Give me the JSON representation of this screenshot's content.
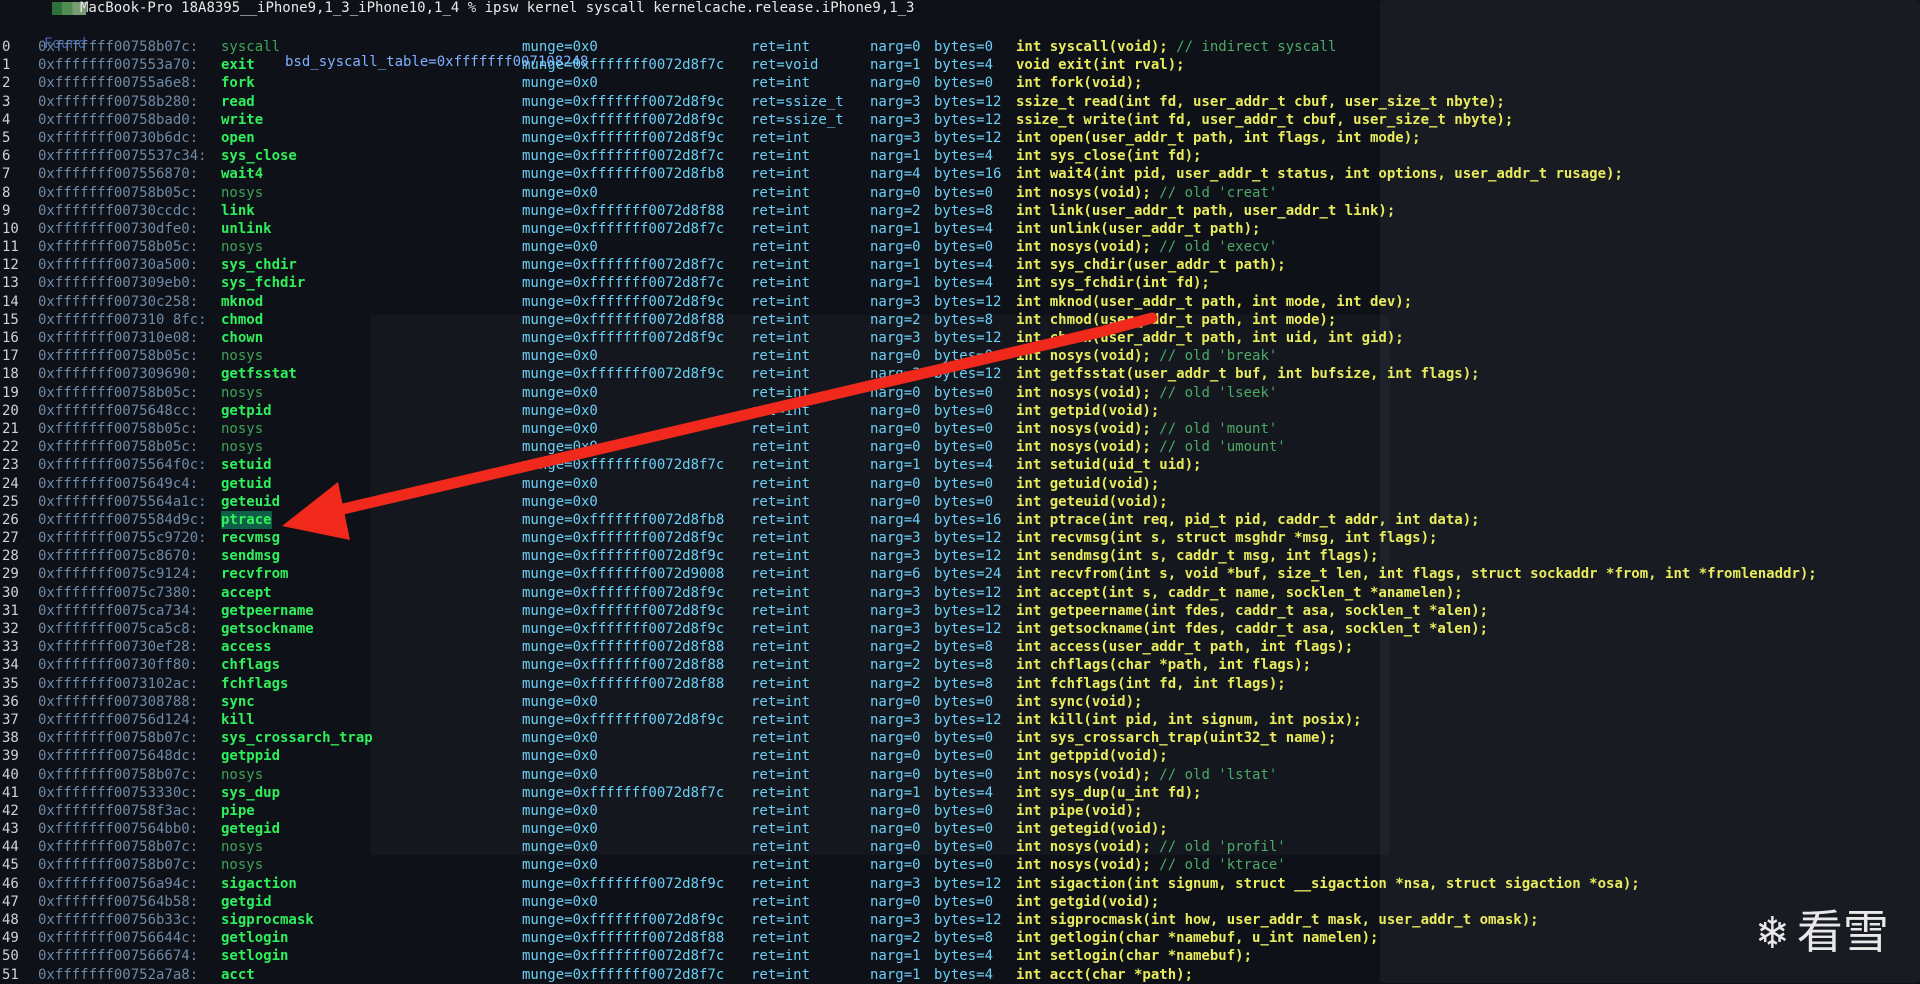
{
  "header": {
    "host": "MacBook-Pro",
    "path": "18A8395__iPhone9,1_3_iPhone10,1_4",
    "prompt_char": "%",
    "command": "ipsw kernel syscall kernelcache.release.iPhone9,1_3",
    "found_label": "Found",
    "table_label": "bsd_syscall_table=0xfffffff007108248"
  },
  "rows": [
    {
      "num": "0",
      "addr": "0xfffffff00758b07c:",
      "name": "syscall",
      "munge": "munge=0x0",
      "ret": "ret=int",
      "narg": "narg=0",
      "bytes": "bytes=0",
      "proto": "int syscall(void); ",
      "comment": "// indirect syscall"
    },
    {
      "num": "1",
      "addr": "0xfffffff007553a70:",
      "name": "exit",
      "munge": "munge=0xfffffff0072d8f7c",
      "ret": "ret=void",
      "narg": "narg=1",
      "bytes": "bytes=4",
      "proto": "void exit(int rval);",
      "comment": ""
    },
    {
      "num": "2",
      "addr": "0xfffffff00755a6e8:",
      "name": "fork",
      "munge": "munge=0x0",
      "ret": "ret=int",
      "narg": "narg=0",
      "bytes": "bytes=0",
      "proto": "int fork(void);",
      "comment": ""
    },
    {
      "num": "3",
      "addr": "0xfffffff00758b280:",
      "name": "read",
      "munge": "munge=0xfffffff0072d8f9c",
      "ret": "ret=ssize_t",
      "narg": "narg=3",
      "bytes": "bytes=12",
      "proto": "ssize_t read(int fd, user_addr_t cbuf, user_size_t nbyte);",
      "comment": ""
    },
    {
      "num": "4",
      "addr": "0xfffffff00758bad0:",
      "name": "write",
      "munge": "munge=0xfffffff0072d8f9c",
      "ret": "ret=ssize_t",
      "narg": "narg=3",
      "bytes": "bytes=12",
      "proto": "ssize_t write(int fd, user_addr_t cbuf, user_size_t nbyte);",
      "comment": ""
    },
    {
      "num": "5",
      "addr": "0xfffffff00730b6dc:",
      "name": "open",
      "munge": "munge=0xfffffff0072d8f9c",
      "ret": "ret=int",
      "narg": "narg=3",
      "bytes": "bytes=12",
      "proto": "int open(user_addr_t path, int flags, int mode);",
      "comment": ""
    },
    {
      "num": "6",
      "addr": "0xfffffff0075537c34:",
      "name": "sys_close",
      "munge": "munge=0xfffffff0072d8f7c",
      "ret": "ret=int",
      "narg": "narg=1",
      "bytes": "bytes=4",
      "proto": "int sys_close(int fd);",
      "comment": ""
    },
    {
      "num": "7",
      "addr": "0xfffffff007556870:",
      "name": "wait4",
      "munge": "munge=0xfffffff0072d8fb8",
      "ret": "ret=int",
      "narg": "narg=4",
      "bytes": "bytes=16",
      "proto": "int wait4(int pid, user_addr_t status, int options, user_addr_t rusage);",
      "comment": ""
    },
    {
      "num": "8",
      "addr": "0xfffffff00758b05c:",
      "name": "nosys",
      "munge": "munge=0x0",
      "ret": "ret=int",
      "narg": "narg=0",
      "bytes": "bytes=0",
      "proto": "int nosys(void); ",
      "comment": "// old 'creat'"
    },
    {
      "num": "9",
      "addr": "0xfffffff00730ccdc:",
      "name": "link",
      "munge": "munge=0xfffffff0072d8f88",
      "ret": "ret=int",
      "narg": "narg=2",
      "bytes": "bytes=8",
      "proto": "int link(user_addr_t path, user_addr_t link);",
      "comment": ""
    },
    {
      "num": "10",
      "addr": "0xfffffff00730dfe0:",
      "name": "unlink",
      "munge": "munge=0xfffffff0072d8f7c",
      "ret": "ret=int",
      "narg": "narg=1",
      "bytes": "bytes=4",
      "proto": "int unlink(user_addr_t path);",
      "comment": ""
    },
    {
      "num": "11",
      "addr": "0xfffffff00758b05c:",
      "name": "nosys",
      "munge": "munge=0x0",
      "ret": "ret=int",
      "narg": "narg=0",
      "bytes": "bytes=0",
      "proto": "int nosys(void); ",
      "comment": "// old 'execv'"
    },
    {
      "num": "12",
      "addr": "0xfffffff00730a500:",
      "name": "sys_chdir",
      "munge": "munge=0xfffffff0072d8f7c",
      "ret": "ret=int",
      "narg": "narg=1",
      "bytes": "bytes=4",
      "proto": "int sys_chdir(user_addr_t path);",
      "comment": ""
    },
    {
      "num": "13",
      "addr": "0xfffffff007309eb0:",
      "name": "sys_fchdir",
      "munge": "munge=0xfffffff0072d8f7c",
      "ret": "ret=int",
      "narg": "narg=1",
      "bytes": "bytes=4",
      "proto": "int sys_fchdir(int fd);",
      "comment": ""
    },
    {
      "num": "14",
      "addr": "0xfffffff00730c258:",
      "name": "mknod",
      "munge": "munge=0xfffffff0072d8f9c",
      "ret": "ret=int",
      "narg": "narg=3",
      "bytes": "bytes=12",
      "proto": "int mknod(user_addr_t path, int mode, int dev);",
      "comment": ""
    },
    {
      "num": "15",
      "addr": "0xfffffff007310 8fc:",
      "name": "chmod",
      "munge": "munge=0xfffffff0072d8f88",
      "ret": "ret=int",
      "narg": "narg=2",
      "bytes": "bytes=8",
      "proto": "int chmod(user_addr_t path, int mode);",
      "comment": ""
    },
    {
      "num": "16",
      "addr": "0xfffffff007310e08:",
      "name": "chown",
      "munge": "munge=0xfffffff0072d8f9c",
      "ret": "ret=int",
      "narg": "narg=3",
      "bytes": "bytes=12",
      "proto": "int chown(user_addr_t path, int uid, int gid);",
      "comment": ""
    },
    {
      "num": "17",
      "addr": "0xfffffff00758b05c:",
      "name": "nosys",
      "munge": "munge=0x0",
      "ret": "ret=int",
      "narg": "narg=0",
      "bytes": "bytes=0",
      "proto": "int nosys(void); ",
      "comment": "// old 'break'"
    },
    {
      "num": "18",
      "addr": "0xfffffff007309690:",
      "name": "getfsstat",
      "munge": "munge=0xfffffff0072d8f9c",
      "ret": "ret=int",
      "narg": "narg=3",
      "bytes": "bytes=12",
      "proto": "int getfsstat(user_addr_t buf, int bufsize, int flags);",
      "comment": ""
    },
    {
      "num": "19",
      "addr": "0xfffffff00758b05c:",
      "name": "nosys",
      "munge": "munge=0x0",
      "ret": "ret=int",
      "narg": "narg=0",
      "bytes": "bytes=0",
      "proto": "int nosys(void); ",
      "comment": "// old 'lseek'"
    },
    {
      "num": "20",
      "addr": "0xfffffff0075648cc:",
      "name": "getpid",
      "munge": "munge=0x0",
      "ret": "ret=int",
      "narg": "narg=0",
      "bytes": "bytes=0",
      "proto": "int getpid(void);",
      "comment": ""
    },
    {
      "num": "21",
      "addr": "0xfffffff00758b05c:",
      "name": "nosys",
      "munge": "munge=0x0",
      "ret": "ret=int",
      "narg": "narg=0",
      "bytes": "bytes=0",
      "proto": "int nosys(void); ",
      "comment": "// old 'mount'"
    },
    {
      "num": "22",
      "addr": "0xfffffff00758b05c:",
      "name": "nosys",
      "munge": "munge=0x0",
      "ret": "ret=int",
      "narg": "narg=0",
      "bytes": "bytes=0",
      "proto": "int nosys(void); ",
      "comment": "// old 'umount'"
    },
    {
      "num": "23",
      "addr": "0xfffffff0075564f0c:",
      "name": "setuid",
      "munge": "munge=0xfffffff0072d8f7c",
      "ret": "ret=int",
      "narg": "narg=1",
      "bytes": "bytes=4",
      "proto": "int setuid(uid_t uid);",
      "comment": ""
    },
    {
      "num": "24",
      "addr": "0xfffffff0075649c4:",
      "name": "getuid",
      "munge": "munge=0x0",
      "ret": "ret=int",
      "narg": "narg=0",
      "bytes": "bytes=0",
      "proto": "int getuid(void);",
      "comment": ""
    },
    {
      "num": "25",
      "addr": "0xfffffff0075564a1c:",
      "name": "geteuid",
      "munge": "munge=0x0",
      "ret": "ret=int",
      "narg": "narg=0",
      "bytes": "bytes=0",
      "proto": "int geteuid(void);",
      "comment": ""
    },
    {
      "num": "26",
      "addr": "0xfffffff0075584d9c:",
      "name": "ptrace",
      "munge": "munge=0xfffffff0072d8fb8",
      "ret": "ret=int",
      "narg": "narg=4",
      "bytes": "bytes=16",
      "proto": "int ptrace(int req, pid_t pid, caddr_t addr, int data);",
      "comment": "",
      "highlight": true
    },
    {
      "num": "27",
      "addr": "0xfffffff00755c9720:",
      "name": "recvmsg",
      "munge": "munge=0xfffffff0072d8f9c",
      "ret": "ret=int",
      "narg": "narg=3",
      "bytes": "bytes=12",
      "proto": "int recvmsg(int s, struct msghdr *msg, int flags);",
      "comment": ""
    },
    {
      "num": "28",
      "addr": "0xfffffff0075c8670:",
      "name": "sendmsg",
      "munge": "munge=0xfffffff0072d8f9c",
      "ret": "ret=int",
      "narg": "narg=3",
      "bytes": "bytes=12",
      "proto": "int sendmsg(int s, caddr_t msg, int flags);",
      "comment": ""
    },
    {
      "num": "29",
      "addr": "0xfffffff0075c9124:",
      "name": "recvfrom",
      "munge": "munge=0xfffffff0072d9008",
      "ret": "ret=int",
      "narg": "narg=6",
      "bytes": "bytes=24",
      "proto": "int recvfrom(int s, void *buf, size_t len, int flags, struct sockaddr *from, int *fromlenaddr);",
      "comment": ""
    },
    {
      "num": "30",
      "addr": "0xfffffff0075c7380:",
      "name": "accept",
      "munge": "munge=0xfffffff0072d8f9c",
      "ret": "ret=int",
      "narg": "narg=3",
      "bytes": "bytes=12",
      "proto": "int accept(int s, caddr_t name, socklen_t *anamelen);",
      "comment": ""
    },
    {
      "num": "31",
      "addr": "0xfffffff0075ca734:",
      "name": "getpeername",
      "munge": "munge=0xfffffff0072d8f9c",
      "ret": "ret=int",
      "narg": "narg=3",
      "bytes": "bytes=12",
      "proto": "int getpeername(int fdes, caddr_t asa, socklen_t *alen);",
      "comment": ""
    },
    {
      "num": "32",
      "addr": "0xfffffff0075ca5c8:",
      "name": "getsockname",
      "munge": "munge=0xfffffff0072d8f9c",
      "ret": "ret=int",
      "narg": "narg=3",
      "bytes": "bytes=12",
      "proto": "int getsockname(int fdes, caddr_t asa, socklen_t *alen);",
      "comment": ""
    },
    {
      "num": "33",
      "addr": "0xfffffff00730ef28:",
      "name": "access",
      "munge": "munge=0xfffffff0072d8f88",
      "ret": "ret=int",
      "narg": "narg=2",
      "bytes": "bytes=8",
      "proto": "int access(user_addr_t path, int flags);",
      "comment": ""
    },
    {
      "num": "34",
      "addr": "0xfffffff00730ff80:",
      "name": "chflags",
      "munge": "munge=0xfffffff0072d8f88",
      "ret": "ret=int",
      "narg": "narg=2",
      "bytes": "bytes=8",
      "proto": "int chflags(char *path, int flags);",
      "comment": ""
    },
    {
      "num": "35",
      "addr": "0xfffffff0073102ac:",
      "name": "fchflags",
      "munge": "munge=0xfffffff0072d8f88",
      "ret": "ret=int",
      "narg": "narg=2",
      "bytes": "bytes=8",
      "proto": "int fchflags(int fd, int flags);",
      "comment": ""
    },
    {
      "num": "36",
      "addr": "0xfffffff007308788:",
      "name": "sync",
      "munge": "munge=0x0",
      "ret": "ret=int",
      "narg": "narg=0",
      "bytes": "bytes=0",
      "proto": "int sync(void);",
      "comment": ""
    },
    {
      "num": "37",
      "addr": "0xfffffff00756d124:",
      "name": "kill",
      "munge": "munge=0xfffffff0072d8f9c",
      "ret": "ret=int",
      "narg": "narg=3",
      "bytes": "bytes=12",
      "proto": "int kill(int pid, int signum, int posix);",
      "comment": ""
    },
    {
      "num": "38",
      "addr": "0xfffffff00758b07c:",
      "name": "sys_crossarch_trap",
      "munge": "munge=0x0",
      "ret": "ret=int",
      "narg": "narg=0",
      "bytes": "bytes=0",
      "proto": "int sys_crossarch_trap(uint32_t name);",
      "comment": ""
    },
    {
      "num": "39",
      "addr": "0xfffffff0075648dc:",
      "name": "getppid",
      "munge": "munge=0x0",
      "ret": "ret=int",
      "narg": "narg=0",
      "bytes": "bytes=0",
      "proto": "int getppid(void);",
      "comment": ""
    },
    {
      "num": "40",
      "addr": "0xfffffff00758b07c:",
      "name": "nosys",
      "munge": "munge=0x0",
      "ret": "ret=int",
      "narg": "narg=0",
      "bytes": "bytes=0",
      "proto": "int nosys(void); ",
      "comment": "// old 'lstat'"
    },
    {
      "num": "41",
      "addr": "0xfffffff00753330c:",
      "name": "sys_dup",
      "munge": "munge=0xfffffff0072d8f7c",
      "ret": "ret=int",
      "narg": "narg=1",
      "bytes": "bytes=4",
      "proto": "int sys_dup(u_int fd);",
      "comment": ""
    },
    {
      "num": "42",
      "addr": "0xfffffff00758f3ac:",
      "name": "pipe",
      "munge": "munge=0x0",
      "ret": "ret=int",
      "narg": "narg=0",
      "bytes": "bytes=0",
      "proto": "int pipe(void);",
      "comment": ""
    },
    {
      "num": "43",
      "addr": "0xfffffff007564bb0:",
      "name": "getegid",
      "munge": "munge=0x0",
      "ret": "ret=int",
      "narg": "narg=0",
      "bytes": "bytes=0",
      "proto": "int getegid(void);",
      "comment": ""
    },
    {
      "num": "44",
      "addr": "0xfffffff00758b07c:",
      "name": "nosys",
      "munge": "munge=0x0",
      "ret": "ret=int",
      "narg": "narg=0",
      "bytes": "bytes=0",
      "proto": "int nosys(void); ",
      "comment": "// old 'profil'"
    },
    {
      "num": "45",
      "addr": "0xfffffff00758b07c:",
      "name": "nosys",
      "munge": "munge=0x0",
      "ret": "ret=int",
      "narg": "narg=0",
      "bytes": "bytes=0",
      "proto": "int nosys(void); ",
      "comment": "// old 'ktrace'"
    },
    {
      "num": "46",
      "addr": "0xfffffff00756a94c:",
      "name": "sigaction",
      "munge": "munge=0xfffffff0072d8f9c",
      "ret": "ret=int",
      "narg": "narg=3",
      "bytes": "bytes=12",
      "proto": "int sigaction(int signum, struct __sigaction *nsa, struct sigaction *osa);",
      "comment": ""
    },
    {
      "num": "47",
      "addr": "0xfffffff007564b58:",
      "name": "getgid",
      "munge": "munge=0x0",
      "ret": "ret=int",
      "narg": "narg=0",
      "bytes": "bytes=0",
      "proto": "int getgid(void);",
      "comment": ""
    },
    {
      "num": "48",
      "addr": "0xfffffff00756b33c:",
      "name": "sigprocmask",
      "munge": "munge=0xfffffff0072d8f9c",
      "ret": "ret=int",
      "narg": "narg=3",
      "bytes": "bytes=12",
      "proto": "int sigprocmask(int how, user_addr_t mask, user_addr_t omask);",
      "comment": ""
    },
    {
      "num": "49",
      "addr": "0xfffffff00756644c:",
      "name": "getlogin",
      "munge": "munge=0xfffffff0072d8f88",
      "ret": "ret=int",
      "narg": "narg=2",
      "bytes": "bytes=8",
      "proto": "int getlogin(char *namebuf, u_int namelen);",
      "comment": ""
    },
    {
      "num": "50",
      "addr": "0xfffffff007566674:",
      "name": "setlogin",
      "munge": "munge=0xfffffff0072d8f7c",
      "ret": "ret=int",
      "narg": "narg=1",
      "bytes": "bytes=4",
      "proto": "int setlogin(char *namebuf);",
      "comment": ""
    },
    {
      "num": "51",
      "addr": "0xfffffff00752a7a8:",
      "name": "acct",
      "munge": "munge=0xfffffff0072d8f7c",
      "ret": "ret=int",
      "narg": "narg=1",
      "bytes": "bytes=4",
      "proto": "int acct(char *path);",
      "comment": ""
    }
  ],
  "watermark": {
    "icon": "snowflake-icon",
    "text": "看雪"
  },
  "colors": {
    "background": "#0e1117",
    "name": "#2ff05a",
    "munge": "#6ccff6",
    "proto": "#e9ec5c",
    "arrow": "#f0291c"
  }
}
